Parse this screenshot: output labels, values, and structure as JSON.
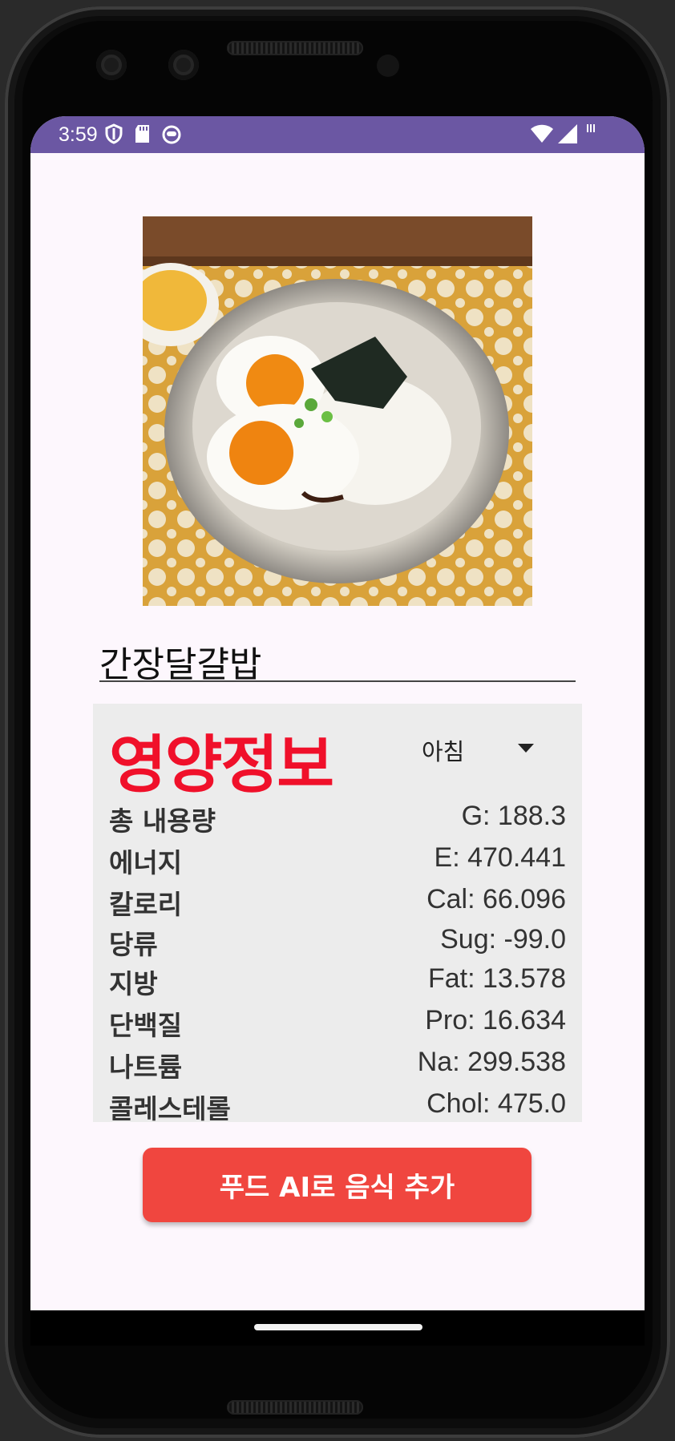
{
  "status_bar": {
    "time": "3:59"
  },
  "food": {
    "name": "간장달걀밥"
  },
  "nutrition": {
    "title": "영양정보",
    "meal": "아침",
    "rows": [
      {
        "label": "총 내용량",
        "value": "G: 188.3"
      },
      {
        "label": "에너지",
        "value": "E: 470.441"
      },
      {
        "label": "칼로리",
        "value": "Cal: 66.096"
      },
      {
        "label": "당류",
        "value": "Sug: -99.0"
      },
      {
        "label": "지방",
        "value": "Fat: 13.578"
      },
      {
        "label": "단백질",
        "value": "Pro: 16.634"
      },
      {
        "label": "나트륨",
        "value": "Na: 299.538"
      },
      {
        "label": "콜레스테롤",
        "value": "Chol: 475.0"
      }
    ]
  },
  "actions": {
    "add_food_ai": "푸드 AI로 음식 추가"
  },
  "colors": {
    "status_bar": "#6b57a3",
    "title": "#f0102a",
    "button": "#f0463f",
    "panel": "#ececec"
  }
}
